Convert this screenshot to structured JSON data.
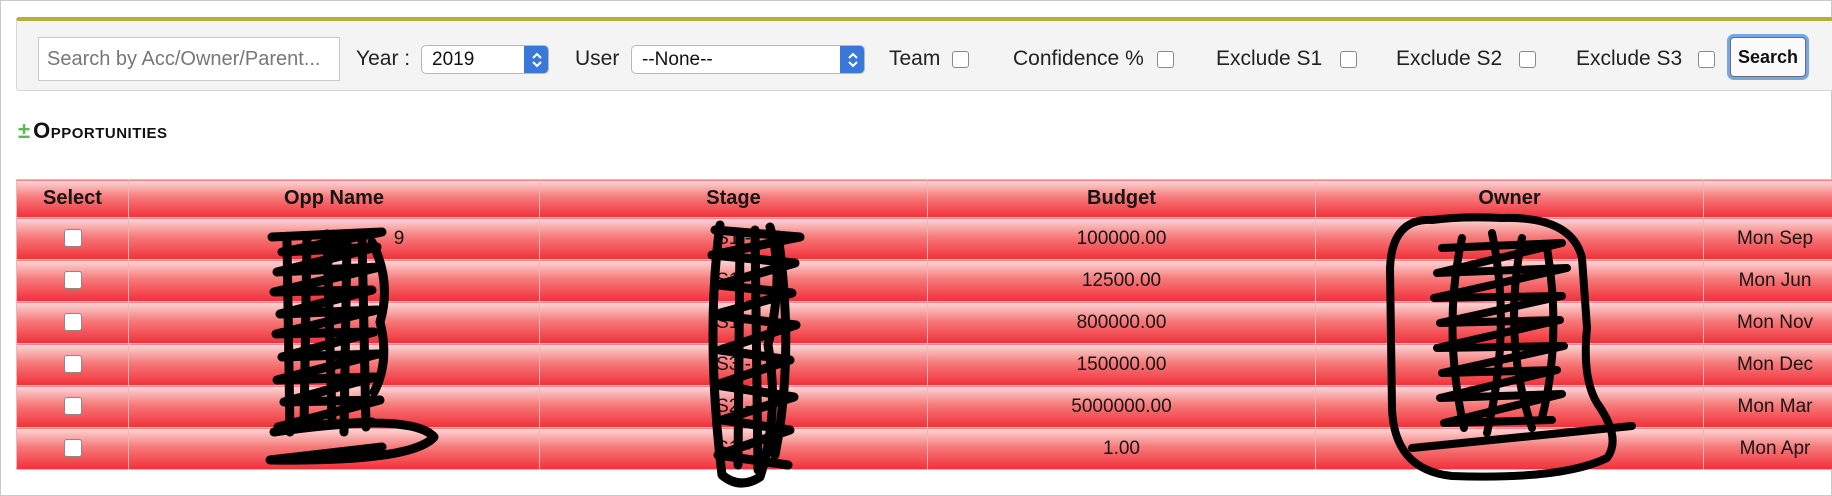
{
  "filters": {
    "search_placeholder": "Search by Acc/Owner/Parent...",
    "year_label": "Year :",
    "year_value": "2019",
    "user_label": "User",
    "user_value": "--None--",
    "team_label": "Team",
    "confidence_label": "Confidence %",
    "exclude_s1_label": "Exclude S1",
    "exclude_s2_label": "Exclude S2",
    "exclude_s3_label": "Exclude S3",
    "search_button": "Search"
  },
  "section": {
    "toggle": "±",
    "title": "Opportunities"
  },
  "table": {
    "headers": [
      "Select",
      "Opp Name",
      "Stage",
      "Budget",
      "Owner"
    ],
    "rows": [
      {
        "opp_name": "9",
        "stage": "S1 -",
        "budget": "100000.00",
        "close": "Mon Sep"
      },
      {
        "opp_name": "",
        "stage": "S1 -",
        "budget": "12500.00",
        "close": "Mon Jun"
      },
      {
        "opp_name": "",
        "stage": "S1 -",
        "budget": "800000.00",
        "close": "Mon Nov"
      },
      {
        "opp_name": "",
        "stage": "S3 -",
        "budget": "150000.00",
        "close": "Mon Dec"
      },
      {
        "opp_name": "",
        "stage": "S2 -",
        "budget": "5000000.00",
        "close": "Mon Mar"
      },
      {
        "opp_name": "",
        "stage": "S1 -",
        "budget": "1.00",
        "close": "Mon Apr"
      }
    ]
  },
  "colors": {
    "accent_bar": "#b3b040",
    "row_red": "#f1303a",
    "button_focus": "#76a6ea"
  }
}
